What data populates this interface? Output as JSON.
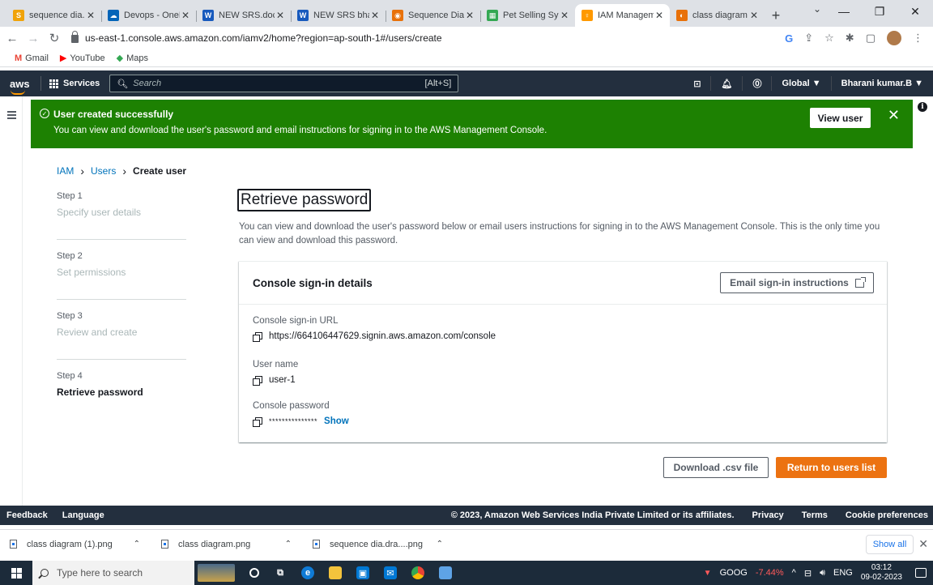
{
  "browser": {
    "tabs": [
      {
        "title": "sequence dia.d",
        "color": "#f0a30a",
        "glyph": "S"
      },
      {
        "title": "Devops - OneD",
        "color": "#0364b8",
        "glyph": "☁"
      },
      {
        "title": "NEW SRS.docx",
        "color": "#185abd",
        "glyph": "W"
      },
      {
        "title": "NEW SRS bhara",
        "color": "#185abd",
        "glyph": "W"
      },
      {
        "title": "Sequence Diag",
        "color": "#e8710a",
        "glyph": "◉"
      },
      {
        "title": "Pet Selling Syst",
        "color": "#34a853",
        "glyph": "▦"
      },
      {
        "title": "IAM Managem",
        "color": "#ff9900",
        "glyph": "♀",
        "active": true
      },
      {
        "title": "class diagram",
        "color": "#e8710a",
        "glyph": "◐"
      }
    ],
    "new_tab": "+",
    "url": "us-east-1.console.aws.amazon.com/iamv2/home?region=ap-south-1#/users/create",
    "bookmarks": [
      {
        "label": "Gmail",
        "glyph": "M",
        "color": "#ea4335"
      },
      {
        "label": "YouTube",
        "glyph": "▶",
        "color": "#ff0000"
      },
      {
        "label": "Maps",
        "glyph": "◆",
        "color": "#34a853"
      }
    ]
  },
  "aws_nav": {
    "logo": "aws",
    "services": "Services",
    "search_placeholder": "Search",
    "search_shortcut": "[Alt+S]",
    "region": "Global ▼",
    "account": "Bharani kumar.B ▼"
  },
  "banner": {
    "title": "User created successfully",
    "message": "You can view and download the user's password and email instructions for signing in to the AWS Management Console.",
    "view_user": "View user",
    "color": "#1d8102"
  },
  "breadcrumb": {
    "iam": "IAM",
    "users": "Users",
    "current": "Create user"
  },
  "steps": [
    {
      "num": "Step 1",
      "name": "Specify user details"
    },
    {
      "num": "Step 2",
      "name": "Set permissions"
    },
    {
      "num": "Step 3",
      "name": "Review and create"
    },
    {
      "num": "Step 4",
      "name": "Retrieve password",
      "current": true
    }
  ],
  "page": {
    "title": "Retrieve password",
    "description": "You can view and download the user's password below or email users instructions for signing in to the AWS Management Console. This is the only time you can view and download this password."
  },
  "card": {
    "title": "Console sign-in details",
    "email_button": "Email sign-in instructions",
    "url_label": "Console sign-in URL",
    "url_value": "https://664106447629.signin.aws.amazon.com/console",
    "username_label": "User name",
    "username_value": "user-1",
    "password_label": "Console password",
    "password_value": "***************",
    "show_label": "Show"
  },
  "actions": {
    "download": "Download .csv file",
    "return": "Return to users list",
    "accent": "#ec7211"
  },
  "footer": {
    "feedback": "Feedback",
    "language": "Language",
    "copyright": "© 2023, Amazon Web Services India Private Limited or its affiliates.",
    "privacy": "Privacy",
    "terms": "Terms",
    "cookies": "Cookie preferences"
  },
  "downloads": {
    "items": [
      "class diagram (1).png",
      "class diagram.png",
      "sequence dia.dra....png"
    ],
    "show_all": "Show all"
  },
  "taskbar": {
    "search_placeholder": "Type here to search",
    "stock_name": "GOOG",
    "stock_change": "-7.44%",
    "language": "ENG",
    "time": "03:12",
    "date": "09-02-2023"
  }
}
